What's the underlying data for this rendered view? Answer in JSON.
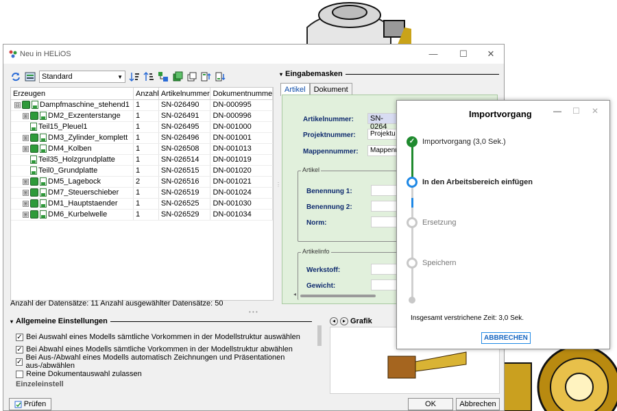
{
  "window": {
    "title": "Neu in HELiOS",
    "min": "—",
    "max": "☐",
    "close": "✕"
  },
  "toolbar": {
    "view_select": "Standard"
  },
  "grid": {
    "headers": [
      "Erzeugen",
      "Anzahl",
      "Artikelnummer",
      "Dokumentnummer"
    ],
    "rows": [
      {
        "name": "Dampfmaschine_stehend1",
        "count": "1",
        "article": "SN-026490",
        "doc": "DN-000995",
        "expander": "⊟",
        "type": "assembly",
        "level": 0
      },
      {
        "name": "DM2_Exzenterstange",
        "count": "1",
        "article": "SN-026491",
        "doc": "DN-000996",
        "expander": "⊞",
        "type": "assembly",
        "level": 1
      },
      {
        "name": "Teil15_Pleuel1",
        "count": "1",
        "article": "SN-026495",
        "doc": "DN-001000",
        "expander": "",
        "type": "part",
        "level": 1
      },
      {
        "name": "DM3_Zylinder_komplett",
        "count": "1",
        "article": "SN-026496",
        "doc": "DN-001001",
        "expander": "⊞",
        "type": "assembly",
        "level": 1
      },
      {
        "name": "DM4_Kolben",
        "count": "1",
        "article": "SN-026508",
        "doc": "DN-001013",
        "expander": "⊞",
        "type": "assembly",
        "level": 1
      },
      {
        "name": "Teil35_Holzgrundplatte",
        "count": "1",
        "article": "SN-026514",
        "doc": "DN-001019",
        "expander": "",
        "type": "part",
        "level": 1
      },
      {
        "name": "Teil0_Grundplatte",
        "count": "1",
        "article": "SN-026515",
        "doc": "DN-001020",
        "expander": "",
        "type": "part",
        "level": 1
      },
      {
        "name": "DM5_Lagebock",
        "count": "2",
        "article": "SN-026516",
        "doc": "DN-001021",
        "expander": "⊞",
        "type": "assembly",
        "level": 1
      },
      {
        "name": "DM7_Steuerschieber",
        "count": "1",
        "article": "SN-026519",
        "doc": "DN-001024",
        "expander": "⊞",
        "type": "assembly",
        "level": 1
      },
      {
        "name": "DM1_Hauptstaender",
        "count": "1",
        "article": "SN-026525",
        "doc": "DN-001030",
        "expander": "⊞",
        "type": "assembly",
        "level": 1
      },
      {
        "name": "DM6_Kurbelwelle",
        "count": "1",
        "article": "SN-026529",
        "doc": "DN-001034",
        "expander": "⊞",
        "type": "assembly",
        "level": 1
      }
    ],
    "status": "Anzahl der Datensätze: 11   Anzahl ausgewählter Datensätze: 50"
  },
  "eingabe": {
    "title": "Eingabemasken",
    "tabs": [
      "Artikel",
      "Dokument"
    ],
    "fields": {
      "artikelnummer_label": "Artikelnummer:",
      "artikelnummer_value": "SN-0264",
      "projektnummer_label": "Projektnummer:",
      "projektnummer_value": "Projektu",
      "mappennummer_label": "Mappennummer:",
      "mappennummer_value": "Mappenu"
    },
    "group_artikel": {
      "title": "Artikel",
      "benennung1": "Benennung 1:",
      "benennung2": "Benennung 2:",
      "norm": "Norm:"
    },
    "group_artikelinfo": {
      "title": "Artikelinfo",
      "werkstoff": "Werkstoff:",
      "gewicht": "Gewicht:"
    }
  },
  "settings": {
    "title": "Allgemeine Einstellungen",
    "options": [
      {
        "label": "Bei Auswahl eines Modells sämtliche Vorkommen in der Modellstruktur auswählen",
        "checked": true
      },
      {
        "label": "Bei Abwahl eines Modells sämtliche Vorkommen in der Modellstruktur abwählen",
        "checked": true
      },
      {
        "label": "Bei Aus-/Abwahl eines Modells automatisch Zeichnungen und Präsentationen aus-/abwählen",
        "checked": true
      },
      {
        "label": "Reine Dokumentauswahl zulassen",
        "checked": false
      }
    ],
    "next_section": "Einzeleinstell"
  },
  "grafik": {
    "title": "Grafik"
  },
  "footer": {
    "pruefen": "Prüfen",
    "ok": "OK",
    "abbrechen": "Abbrechen"
  },
  "dialog": {
    "title": "Importvorgang",
    "steps": [
      {
        "label": "Importvorgang (3,0 Sek.)",
        "state": "done"
      },
      {
        "label": "In den Arbeitsbereich einfügen",
        "state": "active"
      },
      {
        "label": "Ersetzung",
        "state": "pending"
      },
      {
        "label": "Speichern",
        "state": "pending"
      }
    ],
    "elapsed": "Insgesamt verstrichene Zeit: 3,0 Sek.",
    "cancel": "ABBRECHEN",
    "colors": {
      "done": "#1f8a2e",
      "active": "#1e88e5",
      "pending": "#c8c8c8"
    }
  }
}
